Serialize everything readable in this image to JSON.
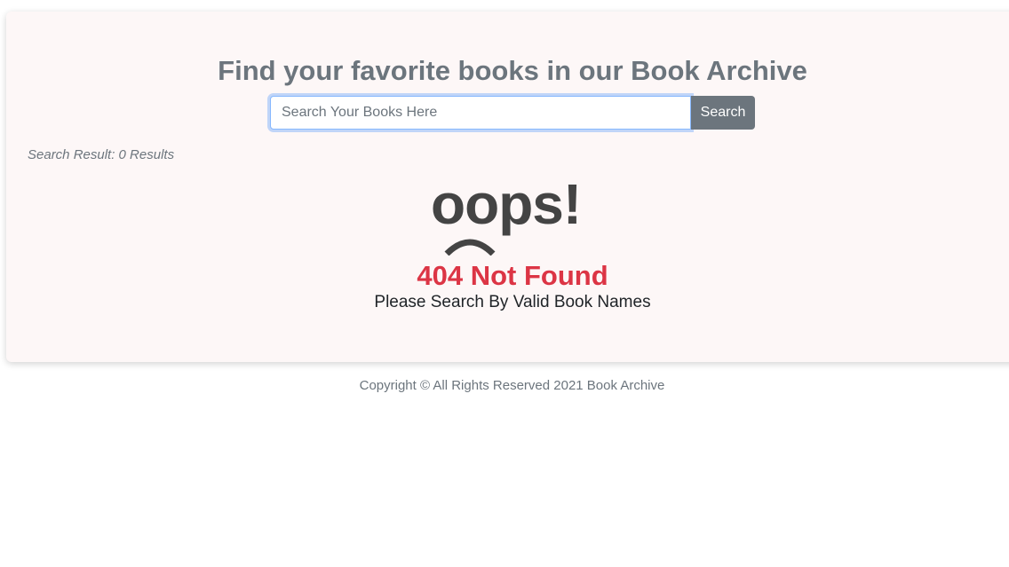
{
  "header": {
    "title": "Find your favorite books in our Book Archive"
  },
  "search": {
    "placeholder": "Search Your Books Here",
    "value": "",
    "button_label": "Search"
  },
  "results": {
    "summary": "Search Result: 0 Results"
  },
  "error": {
    "image_text": "oops!",
    "heading": "404 Not Found",
    "message": "Please Search By Valid Book Names"
  },
  "footer": {
    "copyright": "Copyright © All Rights Reserved 2021 Book Archive"
  },
  "colors": {
    "card_background": "#fdf7f7",
    "title": "#6c757d",
    "button": "#6c757d",
    "error": "#dc3545",
    "oops": "#444444"
  }
}
